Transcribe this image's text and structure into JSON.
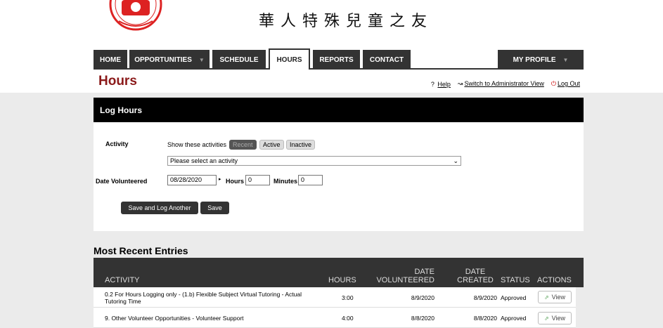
{
  "org": {
    "brand": "華人特殊兒童之友"
  },
  "nav": {
    "tabs": [
      {
        "label": "HOME"
      },
      {
        "label": "OPPORTUNITIES"
      },
      {
        "label": "SCHEDULE"
      },
      {
        "label": "HOURS"
      },
      {
        "label": "REPORTS"
      },
      {
        "label": "CONTACT"
      }
    ],
    "profile": "MY PROFILE",
    "caret": "▼"
  },
  "page": {
    "title": "Hours"
  },
  "links": {
    "help_icon": "?",
    "help": "Help",
    "switch_icon": "↝",
    "switch": "Switch to Administrator View",
    "logout_icon": "⏻",
    "logout": "Log Out"
  },
  "log_hours": {
    "title": "Log Hours",
    "activity_label": "Activity",
    "show_text": "Show these activities",
    "filters": [
      "Recent",
      "Active",
      "Inactive"
    ],
    "select_placeholder": "Please select an activity",
    "select_arrow": "⌄",
    "date_label": "Date Volunteered",
    "date_value": "08/28/2020",
    "calendar_icon": "▸",
    "hours_label": "Hours",
    "hours_value": "0",
    "minutes_label": "Minutes",
    "minutes_value": "0",
    "save_another": "Save and Log Another",
    "save": "Save"
  },
  "recent": {
    "title": "Most Recent Entries",
    "columns": {
      "activity": "ACTIVITY",
      "hours": "HOURS",
      "date_vol_1": "DATE",
      "date_vol_2": "VOLUNTEERED",
      "date_created_1": "DATE",
      "date_created_2": "CREATED",
      "status": "STATUS",
      "actions": "ACTIONS"
    },
    "rows": [
      {
        "activity": "0.2 For Hours Logging only - (1.b) Flexible Subject Virtual Tutoring - Actual Tutoring Time",
        "hours": "3:00",
        "date_volunteered": "8/9/2020",
        "date_created": "8/9/2020",
        "status": "Approved",
        "action": "View"
      },
      {
        "activity": "9. Other Volunteer Opportunities - Volunteer Support",
        "hours": "4:00",
        "date_volunteered": "8/8/2020",
        "date_created": "8/8/2020",
        "status": "Approved",
        "action": "View"
      }
    ],
    "view_icon": "⇗"
  }
}
